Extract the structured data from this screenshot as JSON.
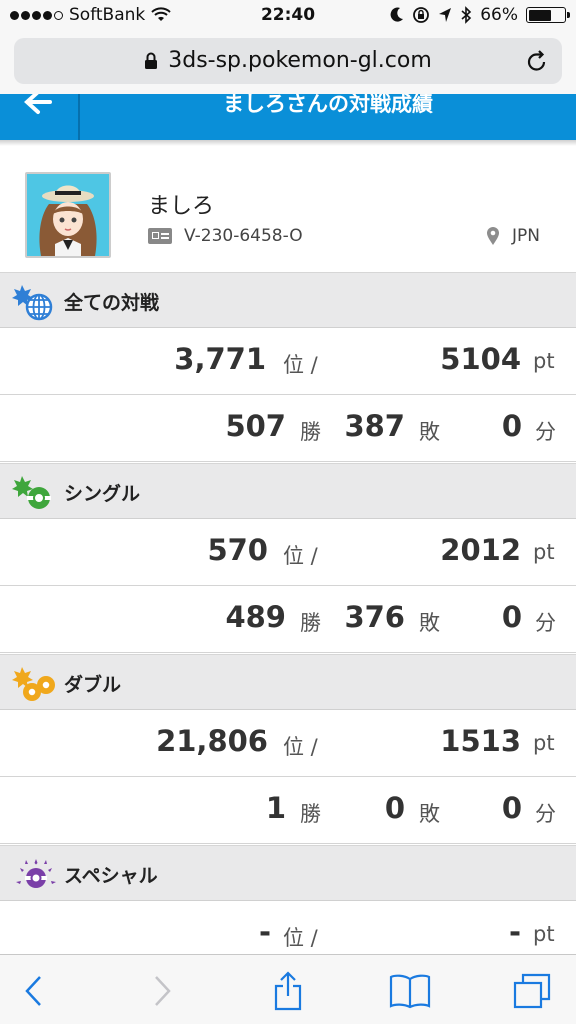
{
  "status_bar": {
    "carrier": "SoftBank",
    "time": "22:40",
    "battery": "66%",
    "battery_level": 0.66
  },
  "browser": {
    "url": "3ds-sp.pokemon-gl.com"
  },
  "header": {
    "title": "ましろさんの対戦成績"
  },
  "profile": {
    "name": "ましろ",
    "id": "V-230-6458-O",
    "region": "JPN"
  },
  "sections": [
    {
      "title": "全ての対戦",
      "icon": "globe-battle-icon",
      "color": "#2f7fd6",
      "rank": "3,771",
      "rank_unit": "位 /",
      "points": "5104",
      "points_unit": "pt",
      "wins": "507",
      "wins_unit": "勝",
      "losses": "387",
      "losses_unit": "敗",
      "draws": "0",
      "draws_unit": "分"
    },
    {
      "title": "シングル",
      "icon": "single-battle-icon",
      "color": "#3fa63c",
      "rank": "570",
      "rank_unit": "位 /",
      "points": "2012",
      "points_unit": "pt",
      "wins": "489",
      "wins_unit": "勝",
      "losses": "376",
      "losses_unit": "敗",
      "draws": "0",
      "draws_unit": "分"
    },
    {
      "title": "ダブル",
      "icon": "double-battle-icon",
      "color": "#f0a81c",
      "rank": "21,806",
      "rank_unit": "位 /",
      "points": "1513",
      "points_unit": "pt",
      "wins": "1",
      "wins_unit": "勝",
      "losses": "0",
      "losses_unit": "敗",
      "draws": "0",
      "draws_unit": "分"
    },
    {
      "title": "スペシャル",
      "icon": "special-battle-icon",
      "color": "#7a3fa8",
      "rank": "-",
      "rank_unit": "位 /",
      "points": "-",
      "points_unit": "pt"
    }
  ]
}
